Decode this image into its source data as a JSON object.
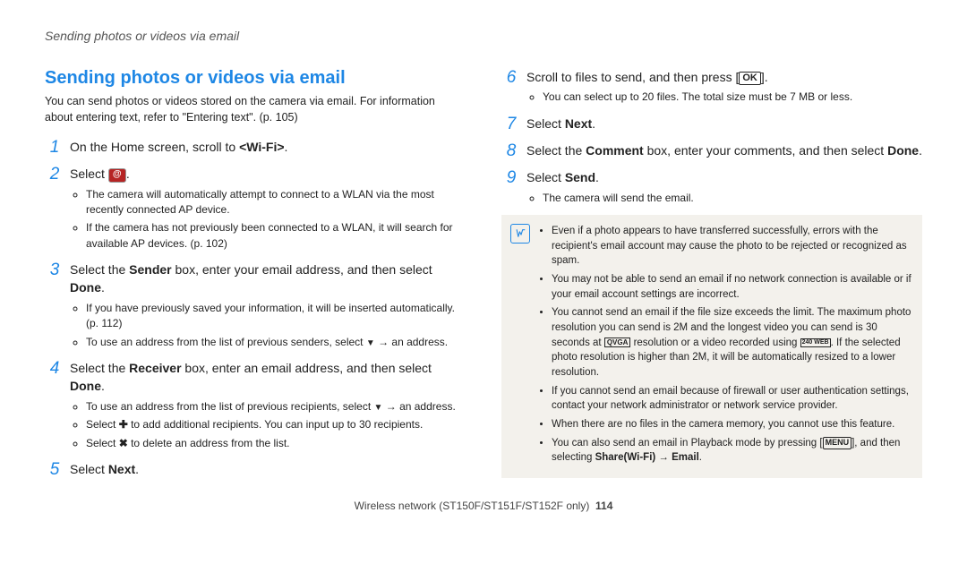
{
  "runningHeader": "Sending photos or videos via email",
  "title": "Sending photos or videos via email",
  "intro": "You can send photos or videos stored on the camera via email. For information about entering text, refer to \"Entering text\". (p. 105)",
  "steps": {
    "s1": {
      "pre": "On the Home screen, scroll to ",
      "wifi": "<Wi-Fi>",
      "post": "."
    },
    "s2": {
      "pre": "Select ",
      "post": "."
    },
    "s2_sub1": "The camera will automatically attempt to connect to a WLAN via the most recently connected AP device.",
    "s2_sub2": "If the camera has not previously been connected to a WLAN, it will search for available AP devices. (p. 102)",
    "s3": {
      "a": "Select the ",
      "b": "Sender",
      "c": " box, enter your email address, and then select ",
      "d": "Done",
      "e": "."
    },
    "s3_sub1": "If you have previously saved your information, it will be inserted automatically. (p. 112)",
    "s3_sub2a": "To use an address from the list of previous senders, select ",
    "s3_sub2b": " an address.",
    "s4": {
      "a": "Select the ",
      "b": "Receiver",
      "c": " box, enter an email address, and then select ",
      "d": "Done",
      "e": "."
    },
    "s4_sub1a": "To use an address from the list of previous recipients, select ",
    "s4_sub1b": " an address.",
    "s4_sub2a": "Select ",
    "s4_sub2b": " to add additional recipients. You can input up to 30 recipients.",
    "s4_sub3a": "Select ",
    "s4_sub3b": " to delete an address from the list.",
    "s5": {
      "a": "Select ",
      "b": "Next",
      "c": "."
    },
    "s6": {
      "a": "Scroll to files to send, and then press [",
      "b": "]."
    },
    "s6_sub1": "You can select up to 20 files. The total size must be 7 MB or less.",
    "s7": {
      "a": "Select ",
      "b": "Next",
      "c": "."
    },
    "s8": {
      "a": "Select the ",
      "b": "Comment",
      "c": " box, enter your comments, and then select ",
      "d": "Done",
      "e": "."
    },
    "s9": {
      "a": "Select ",
      "b": "Send",
      "c": "."
    },
    "s9_sub1": "The camera will send the email."
  },
  "icons": {
    "ok": "OK",
    "menu": "MENU",
    "qvga": "QVGA",
    "vga240": "240\nWEB"
  },
  "note": {
    "n1": "Even if a photo appears to have transferred successfully, errors with the recipient's email account may cause the photo to be rejected or recognized as spam.",
    "n2": "You may not be able to send an email if no network connection is available or if your email account settings are incorrect.",
    "n3a": "You cannot send an email if the file size exceeds the limit. The maximum photo resolution you can send is 2M and the longest video you can send is 30 seconds at ",
    "n3b": " resolution or a video recorded using ",
    "n3c": ". If the selected photo resolution is higher than 2M, it will be automatically resized to a lower resolution.",
    "n4": "If you cannot send an email because of firewall or user authentication settings, contact your network administrator or network service provider.",
    "n5": "When there are no files in the camera memory, you cannot use this feature.",
    "n6a": "You can also send an email in Playback mode by pressing [",
    "n6b": "], and then selecting ",
    "n6c": "Share(Wi-Fi)",
    "n6d": "Email",
    "n6e": "."
  },
  "footer": {
    "text": "Wireless network  (ST150F/ST151F/ST152F only)",
    "page": "114"
  }
}
